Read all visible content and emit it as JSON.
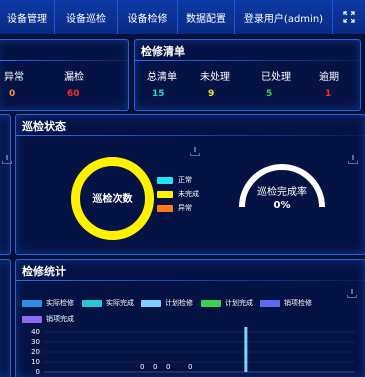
{
  "nav": {
    "items": [
      "设备管理",
      "设备巡检",
      "设备检修",
      "数据配置",
      "登录用户(admin)"
    ],
    "fullscreen_icon": "expand-icon"
  },
  "left_stats": {
    "items": [
      {
        "label": "异常",
        "value": "0",
        "color": "#ff8a3d"
      },
      {
        "label": "漏检",
        "value": "60",
        "color": "#ff2a2a"
      }
    ]
  },
  "repair": {
    "title": "检修清单",
    "items": [
      {
        "label": "总清单",
        "value": "15",
        "color": "#27d6d0"
      },
      {
        "label": "未处理",
        "value": "9",
        "color": "#f4e83a"
      },
      {
        "label": "已处理",
        "value": "5",
        "color": "#3dd24d"
      },
      {
        "label": "逾期",
        "value": "1",
        "color": "#ff2a2a"
      }
    ]
  },
  "inspection": {
    "title": "巡检状态",
    "donut_label": "巡检次数",
    "legend": [
      {
        "label": "正常",
        "color": "#25e4f2"
      },
      {
        "label": "未完成",
        "color": "#fff200"
      },
      {
        "label": "异常",
        "color": "#ff7a1a"
      }
    ],
    "gauge_title": "巡检完成率",
    "gauge_value": "0%",
    "completion_rate": 0
  },
  "stats": {
    "title": "检修统计",
    "legend": [
      {
        "label": "实际检修",
        "color": "#2f8fe6"
      },
      {
        "label": "实际完成",
        "color": "#2ac4d8"
      },
      {
        "label": "计划检修",
        "color": "#7fd0ff"
      },
      {
        "label": "计划完成",
        "color": "#3dd24d"
      },
      {
        "label": "销项检修",
        "color": "#5b6cf0"
      },
      {
        "label": "销项完成",
        "color": "#8c6cf0"
      }
    ]
  },
  "chart_data": {
    "type": "bar",
    "title": "检修统计",
    "ylim": [
      0,
      40
    ],
    "y_ticks": [
      "40",
      "30",
      "20",
      "10",
      "0"
    ],
    "series": [
      {
        "name": "实际检修",
        "values": [
          0,
          0,
          0,
          0,
          0,
          0,
          0,
          0,
          0,
          0,
          0,
          0,
          0,
          0,
          0,
          0
        ]
      },
      {
        "name": "实际完成",
        "values": [
          0,
          0,
          0,
          0,
          0,
          0,
          0,
          0,
          0,
          0,
          0,
          0,
          0,
          0,
          0,
          0
        ]
      },
      {
        "name": "计划检修",
        "values": [
          0,
          0,
          0,
          0,
          0,
          0,
          0,
          0,
          0,
          0,
          45,
          0,
          0,
          0,
          0,
          0
        ]
      },
      {
        "name": "计划完成",
        "values": [
          0,
          0,
          0,
          0,
          0,
          0,
          0,
          0,
          0,
          0,
          0,
          0,
          0,
          0,
          0,
          0
        ]
      },
      {
        "name": "销项检修",
        "values": [
          0,
          0,
          0,
          0,
          0,
          0,
          0,
          0,
          0,
          0,
          0,
          0,
          0,
          0,
          0,
          0
        ]
      },
      {
        "name": "销项完成",
        "values": [
          0,
          0,
          0,
          0,
          0,
          0,
          0,
          0,
          0,
          0,
          0,
          0,
          0,
          0,
          0,
          0
        ]
      }
    ],
    "data_labels": [
      "0",
      "0",
      "0",
      "0"
    ]
  }
}
